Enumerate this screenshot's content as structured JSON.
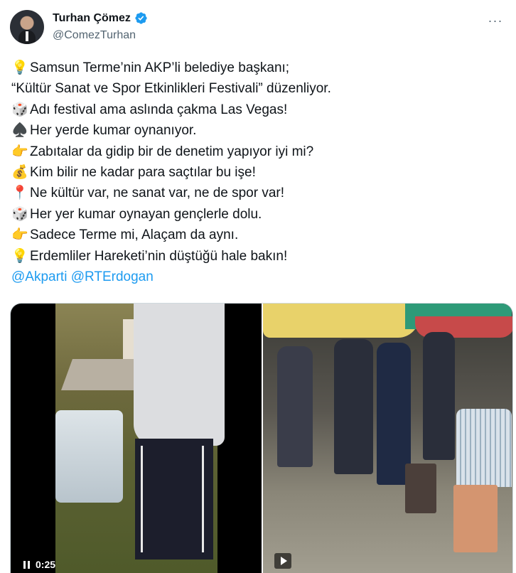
{
  "author": {
    "name": "Turhan Çömez",
    "handle": "@ComezTurhan",
    "verified_color": "#1d9bf0"
  },
  "menu": {
    "more_label": "···"
  },
  "tweet": {
    "lines": [
      {
        "icon": "light-bulb-icon",
        "emoji": "💡",
        "text": "Samsun Terme’nin AKP’li belediye başkanı;"
      },
      {
        "icon": "",
        "emoji": "",
        "text": "“Kültür Sanat ve Spor Etkinlikleri Festivali” düzenliyor."
      },
      {
        "icon": "dice-icon",
        "emoji": "🎲",
        "text": "Adı festival ama aslında çakma Las Vegas!"
      },
      {
        "icon": "spade-icon",
        "emoji": "♠️",
        "text": "Her yerde kumar oynanıyor."
      },
      {
        "icon": "pointing-hand-icon",
        "emoji": "👉",
        "text": "Zabıtalar da gidip bir de denetim yapıyor iyi mi?"
      },
      {
        "icon": "money-bag-icon",
        "emoji": "💰",
        "text": "Kim bilir ne kadar para saçtılar bu işe!"
      },
      {
        "icon": "pin-icon",
        "emoji": "📍",
        "text": "Ne kültür var, ne sanat var, ne de spor var!"
      },
      {
        "icon": "dice-icon",
        "emoji": "🎲",
        "text": "Her yer kumar oynayan gençlerle dolu."
      },
      {
        "icon": "pointing-hand-icon",
        "emoji": "👉",
        "text": "Sadece Terme mi, Alaçam da aynı."
      },
      {
        "icon": "light-bulb-icon",
        "emoji": "💡",
        "text": "Erdemliler Hareketi’nin düştüğü hale bakın!"
      }
    ],
    "mentions": [
      "@Akparti",
      "@RTErdogan"
    ]
  },
  "media": {
    "video_time": "0:25",
    "accent": "#1d9bf0"
  }
}
